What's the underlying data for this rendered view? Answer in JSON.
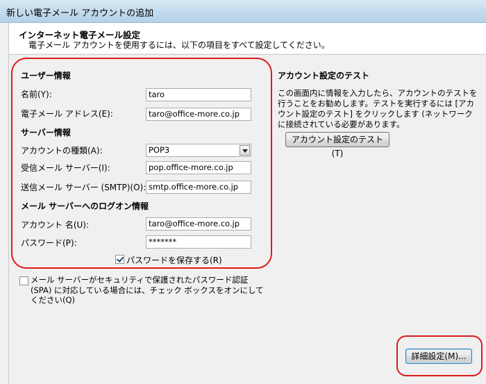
{
  "window": {
    "title": "新しい電子メール アカウントの追加"
  },
  "header": {
    "title": "インターネット電子メール設定",
    "subtitle": "電子メール アカウントを使用するには、以下の項目をすべて設定してください。"
  },
  "user_info": {
    "heading": "ユーザー情報",
    "name_label": "名前(Y):",
    "name_value": "taro",
    "email_label": "電子メール アドレス(E):",
    "email_value": "taro@office-more.co.jp"
  },
  "server_info": {
    "heading": "サーバー情報",
    "account_type_label": "アカウントの種類(A):",
    "account_type_value": "POP3",
    "incoming_label": "受信メール サーバー(I):",
    "incoming_value": "pop.office-more.co.jp",
    "outgoing_label": "送信メール サーバー (SMTP)(O):",
    "outgoing_value": "smtp.office-more.co.jp"
  },
  "logon_info": {
    "heading": "メール サーバーへのログオン情報",
    "account_label": "アカウント 名(U):",
    "account_value": "taro@office-more.co.jp",
    "password_label": "パスワード(P):",
    "password_value": "*******",
    "save_password_label": "パスワードを保存する(R)",
    "save_password_checked": true
  },
  "spa": {
    "label": "メール サーバーがセキュリティで保護されたパスワード認証 (SPA) に対応している場合には、チェック ボックスをオンにしてください(Q)",
    "checked": false
  },
  "test": {
    "heading": "アカウント設定のテスト",
    "description": "この画面内に情報を入力したら、アカウントのテストを行うことをお勧めします。テストを実行するには [アカウント設定のテスト] をクリックします (ネットワークに接続されている必要があります。",
    "button_label": "アカウント設定のテスト(T)"
  },
  "advanced_button_label": "詳細設定(M)...",
  "colors": {
    "highlight": "#e01818",
    "title_bar": "#c0d9ec"
  }
}
